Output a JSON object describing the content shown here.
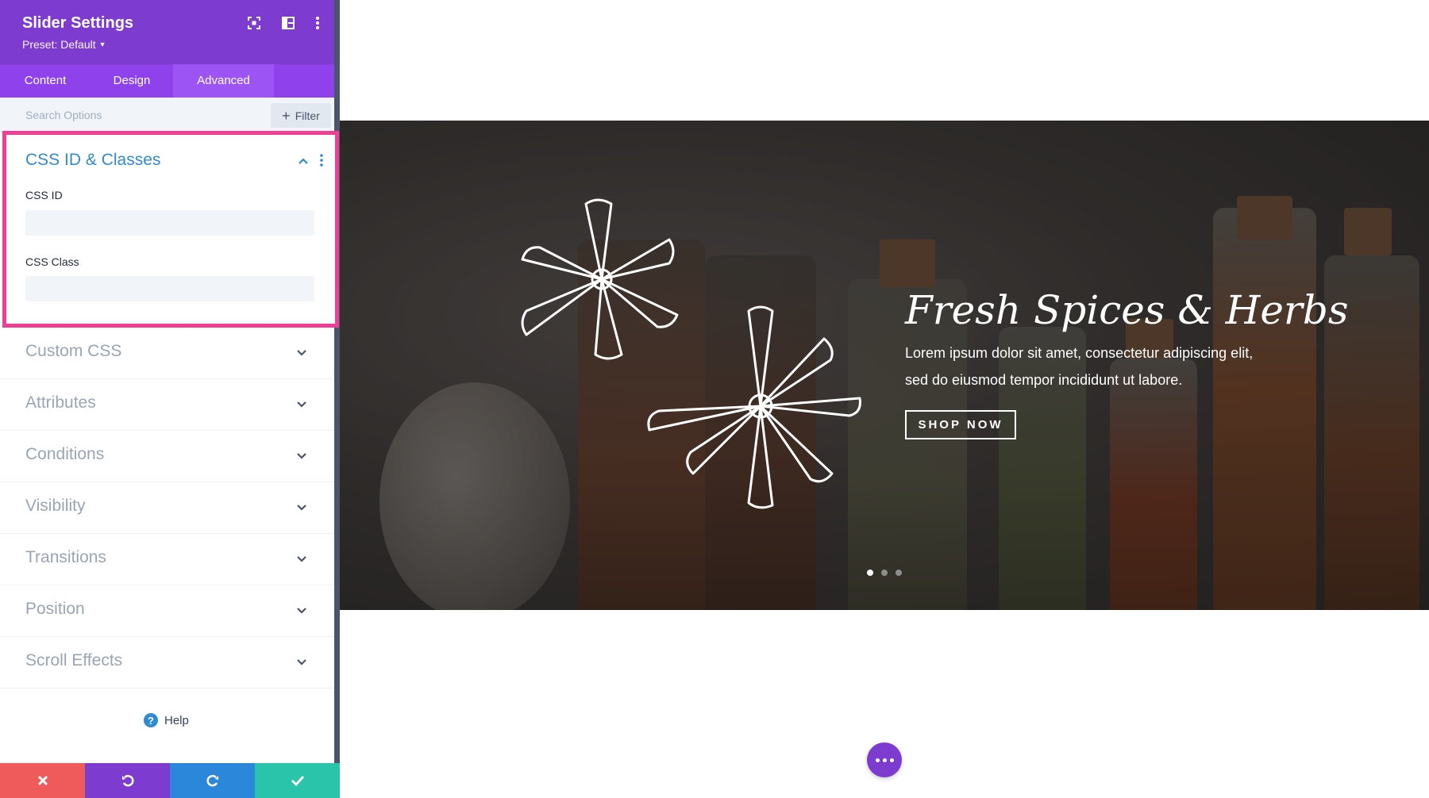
{
  "panel": {
    "title": "Slider Settings",
    "preset": "Preset: Default",
    "tabs": [
      {
        "label": "Content"
      },
      {
        "label": "Design"
      },
      {
        "label": "Advanced",
        "active": true
      }
    ],
    "search": {
      "placeholder": "Search Options"
    },
    "filter_label": "Filter",
    "open_section": {
      "title": "CSS ID & Classes",
      "fields": [
        {
          "label": "CSS ID",
          "value": ""
        },
        {
          "label": "CSS Class",
          "value": ""
        }
      ]
    },
    "sections": [
      {
        "label": "Custom CSS"
      },
      {
        "label": "Attributes"
      },
      {
        "label": "Conditions"
      },
      {
        "label": "Visibility"
      },
      {
        "label": "Transitions"
      },
      {
        "label": "Position"
      },
      {
        "label": "Scroll Effects"
      }
    ],
    "help_label": "Help",
    "colors": {
      "header": "#7e3bd0",
      "tabs": "#8f42ec",
      "highlight_border": "#ee3f94",
      "section_title": "#2e8bd4",
      "discard": "#ef5b5b",
      "undo": "#7e3bd0",
      "redo": "#2b87da",
      "save": "#29c4a9"
    },
    "bottom_bar_icons": [
      "close-icon",
      "undo-icon",
      "redo-icon",
      "check-icon"
    ]
  },
  "slider": {
    "title": "Fresh Spices & Herbs",
    "text": "Lorem ipsum dolor sit amet, consectetur adipiscing elit, sed do eiusmod tempor incididunt ut labore.",
    "button_label": "SHOP NOW",
    "slide_count": 3,
    "active_slide": 1
  }
}
